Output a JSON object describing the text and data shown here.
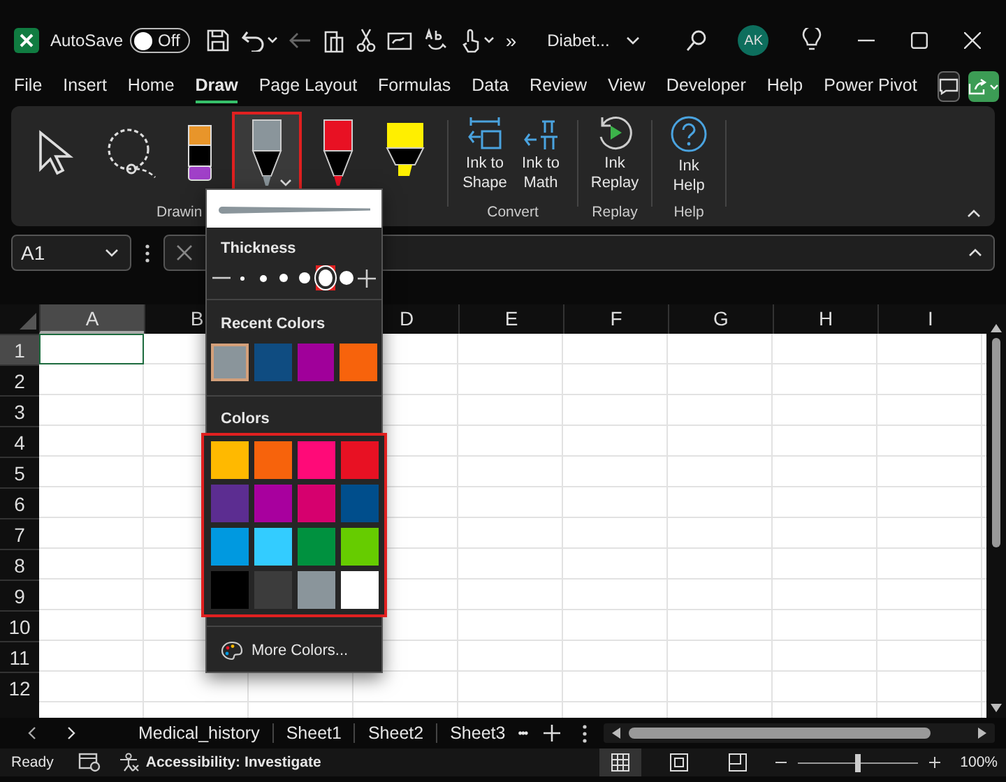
{
  "title_bar": {
    "autosave_label": "AutoSave",
    "autosave_toggle": {
      "label": "Off",
      "on": false
    },
    "overflow": "»",
    "document": "Diabet...",
    "avatar": "AK"
  },
  "menu_tabs": [
    {
      "label": "File",
      "selected": false
    },
    {
      "label": "Insert",
      "selected": false
    },
    {
      "label": "Home",
      "selected": false
    },
    {
      "label": "Draw",
      "selected": true
    },
    {
      "label": "Page Layout",
      "selected": false
    },
    {
      "label": "Formulas",
      "selected": false
    },
    {
      "label": "Data",
      "selected": false
    },
    {
      "label": "Review",
      "selected": false
    },
    {
      "label": "View",
      "selected": false
    },
    {
      "label": "Developer",
      "selected": false
    },
    {
      "label": "Help",
      "selected": false
    },
    {
      "label": "Power Pivot",
      "selected": false
    }
  ],
  "ribbon": {
    "tools": [
      {
        "kind": "select",
        "selected": false
      },
      {
        "kind": "lasso",
        "selected": false
      },
      {
        "kind": "eraser",
        "selected": false
      },
      {
        "kind": "pen",
        "color": "#8a959b",
        "selected": true
      },
      {
        "kind": "pen",
        "color": "#e81123",
        "selected": false
      },
      {
        "kind": "highlighter",
        "color": "#ffef00",
        "selected": false
      }
    ],
    "tools_group": "Drawin",
    "groups": [
      {
        "label": "Convert",
        "buttons": [
          {
            "kind": "shape",
            "label": "Ink to Shape"
          },
          {
            "kind": "math",
            "label": "Ink to Math"
          }
        ]
      },
      {
        "label": "Replay",
        "buttons": [
          {
            "kind": "replay",
            "label": "Ink Replay"
          }
        ]
      },
      {
        "label": "Help",
        "buttons": [
          {
            "kind": "help",
            "label": "Ink Help"
          }
        ]
      }
    ]
  },
  "formula_bar": {
    "name_box": "A1"
  },
  "columns": [
    "A",
    "B",
    "D",
    "E",
    "F",
    "G",
    "H",
    "I"
  ],
  "rows": [
    "1",
    "2",
    "3",
    "4",
    "5",
    "6",
    "7",
    "8",
    "9",
    "10",
    "11",
    "12"
  ],
  "pen_menu": {
    "thickness_title": "Thickness",
    "thickness": [
      {
        "selected": false
      },
      {
        "selected": false
      },
      {
        "selected": false
      },
      {
        "selected": false
      },
      {
        "selected": true
      },
      {
        "selected": false
      }
    ],
    "recent_title": "Recent Colors",
    "recent": [
      {
        "color": "#8a959b",
        "selected": true
      },
      {
        "color": "#0f4c81",
        "selected": false
      },
      {
        "color": "#a0009a",
        "selected": false
      },
      {
        "color": "#f7630c",
        "selected": false
      }
    ],
    "colors_title": "Colors",
    "colors": [
      {
        "color": "#ffb900",
        "selected": false
      },
      {
        "color": "#f7630c",
        "selected": false
      },
      {
        "color": "#ff0a78",
        "selected": false
      },
      {
        "color": "#e81123",
        "selected": false
      },
      {
        "color": "#5c2d91",
        "selected": false
      },
      {
        "color": "#a8009e",
        "selected": false
      },
      {
        "color": "#d6006e",
        "selected": false
      },
      {
        "color": "#004e8c",
        "selected": false
      },
      {
        "color": "#0099e0",
        "selected": false
      },
      {
        "color": "#33ccff",
        "selected": false
      },
      {
        "color": "#00913f",
        "selected": false
      },
      {
        "color": "#66cc00",
        "selected": false
      },
      {
        "color": "#000000",
        "selected": false
      },
      {
        "color": "#3c3c3c",
        "selected": false
      },
      {
        "color": "#8a959b",
        "selected": false
      },
      {
        "color": "#ffffff",
        "selected": false
      }
    ],
    "more_colors": "More Colors..."
  },
  "sheet_tabs": [
    {
      "label": "Medical_history",
      "selected": false
    },
    {
      "label": "Sheet1",
      "selected": false
    },
    {
      "label": "Sheet2",
      "selected": false
    },
    {
      "label": "Sheet3",
      "selected": false
    }
  ],
  "tabs_overflow": "•••",
  "status_bar": {
    "ready": "Ready",
    "accessibility": "Accessibility: Investigate",
    "zoom_slider": {
      "level": 0.5
    },
    "zoom": "100%"
  }
}
